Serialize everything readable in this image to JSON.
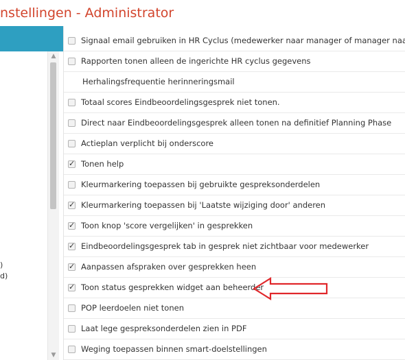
{
  "window": {
    "title": "nstellingen - Administrator"
  },
  "left_panel": {
    "text1": ")",
    "text2": "d)"
  },
  "colors": {
    "title": "#d2442c",
    "accent": "#2e9fc1",
    "arrow": "#e0262a"
  },
  "settings": [
    {
      "label": "Signaal email gebruiken in HR Cyclus (medewerker naar manager of manager naar medew",
      "checked": false,
      "has_checkbox": true
    },
    {
      "label": "Rapporten tonen alleen de ingerichte HR cyclus gegevens",
      "checked": false,
      "has_checkbox": true
    },
    {
      "label": "Herhalingsfrequentie herinneringsmail",
      "checked": false,
      "has_checkbox": false
    },
    {
      "label": "Totaal scores Eindbeoordelingsgesprek niet tonen.",
      "checked": false,
      "has_checkbox": true
    },
    {
      "label": "Direct naar Eindbeoordelingsgesprek alleen tonen na definitief Planning Phase",
      "checked": false,
      "has_checkbox": true
    },
    {
      "label": "Actieplan verplicht bij onderscore",
      "checked": false,
      "has_checkbox": true
    },
    {
      "label": "Tonen help",
      "checked": true,
      "has_checkbox": true
    },
    {
      "label": "Kleurmarkering toepassen bij gebruikte gespreksonderdelen",
      "checked": false,
      "has_checkbox": true
    },
    {
      "label": "Kleurmarkering toepassen bij 'Laatste wijziging door' anderen",
      "checked": true,
      "has_checkbox": true
    },
    {
      "label": "Toon knop 'score vergelijken' in gesprekken",
      "checked": true,
      "has_checkbox": true
    },
    {
      "label": "Eindbeoordelingsgesprek tab in gesprek niet zichtbaar voor medewerker",
      "checked": true,
      "has_checkbox": true
    },
    {
      "label": "Aanpassen afspraken over gesprekken heen",
      "checked": true,
      "has_checkbox": true
    },
    {
      "label": "Toon status gesprekken widget aan beheerder",
      "checked": true,
      "has_checkbox": true
    },
    {
      "label": "POP leerdoelen niet tonen",
      "checked": false,
      "has_checkbox": true
    },
    {
      "label": "Laat lege gespreksonderdelen zien in PDF",
      "checked": false,
      "has_checkbox": true
    },
    {
      "label": "Weging toepassen binnen smart-doelstellingen",
      "checked": false,
      "has_checkbox": true
    }
  ]
}
